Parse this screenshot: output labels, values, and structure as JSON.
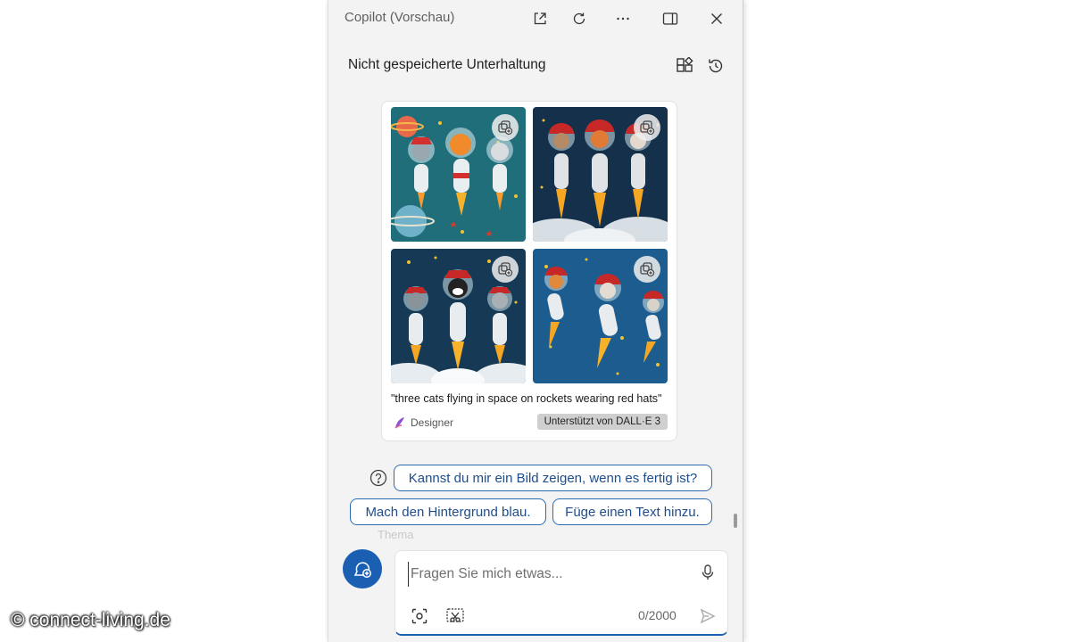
{
  "window": {
    "title": "Copilot (Vorschau)",
    "buttons": [
      "open-in-new-icon",
      "refresh-icon",
      "more-icon",
      "sidepanel-icon",
      "close-icon"
    ]
  },
  "conversation": {
    "title": "Nicht gespeicherte Unterhaltung",
    "buttons": [
      "plugins-icon",
      "history-icon"
    ]
  },
  "image_card": {
    "images": [
      {
        "theme": "orange-tabby-cats-rockets-teal"
      },
      {
        "theme": "helmet-cats-rockets-clouds"
      },
      {
        "theme": "tuxedo-cats-rockets-night"
      },
      {
        "theme": "red-hat-cats-blue-stars"
      }
    ],
    "caption": "\"three cats flying in space on rockets wearing red hats\"",
    "source": "Designer",
    "powered_by": "Unterstützt von DALL·E 3"
  },
  "suggestions": [
    "Kannst du mir ein Bild zeigen, wenn es fertig ist?",
    "Mach den Hintergrund blau.",
    "Füge einen Text hinzu."
  ],
  "ghost_text": "Thema",
  "input": {
    "placeholder": "Fragen Sie mich etwas...",
    "counter": "0/2000"
  },
  "watermark": "© connect-living.de",
  "colors": {
    "accent": "#1b5fb3",
    "chip_text": "#1e4e8c",
    "panel_bg": "#f3f3f3"
  }
}
